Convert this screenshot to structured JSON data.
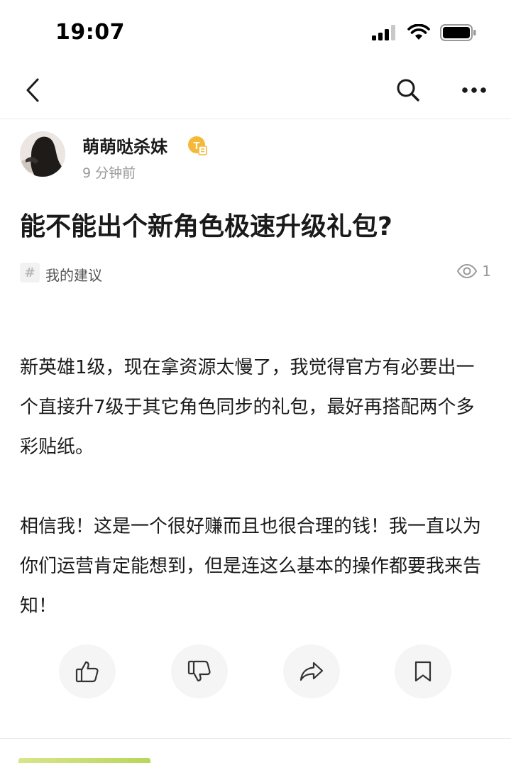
{
  "status_bar": {
    "time": "19:07"
  },
  "author": {
    "name": "萌萌哒杀妹",
    "time_ago": "9 分钟前"
  },
  "post": {
    "title": "能不能出个新角色极速升级礼包?",
    "topic": "我的建议",
    "views": "1",
    "paragraphs": [
      "新英雄1级，现在拿资源太慢了，我觉得官方有必要出一个直接升7级于其它角色同步的礼包，最好再搭配两个多彩贴纸。",
      "相信我！这是一个很好赚而且也很合理的钱！我一直以为你们运营肯定能想到，但是连这么基本的操作都要我来告知！"
    ]
  },
  "icons": {
    "back": "chevron-left-icon",
    "search": "search-icon",
    "more": "more-dots-icon",
    "badge": "level-badge-icon",
    "topic": "hashtag-icon",
    "views": "eye-icon",
    "like": "thumbs-up-icon",
    "dislike": "thumbs-down-icon",
    "share": "share-icon",
    "bookmark": "bookmark-icon"
  },
  "colors": {
    "badge": "#f5b93a",
    "muted_text": "#999999",
    "button_bg": "#f5f5f5"
  }
}
